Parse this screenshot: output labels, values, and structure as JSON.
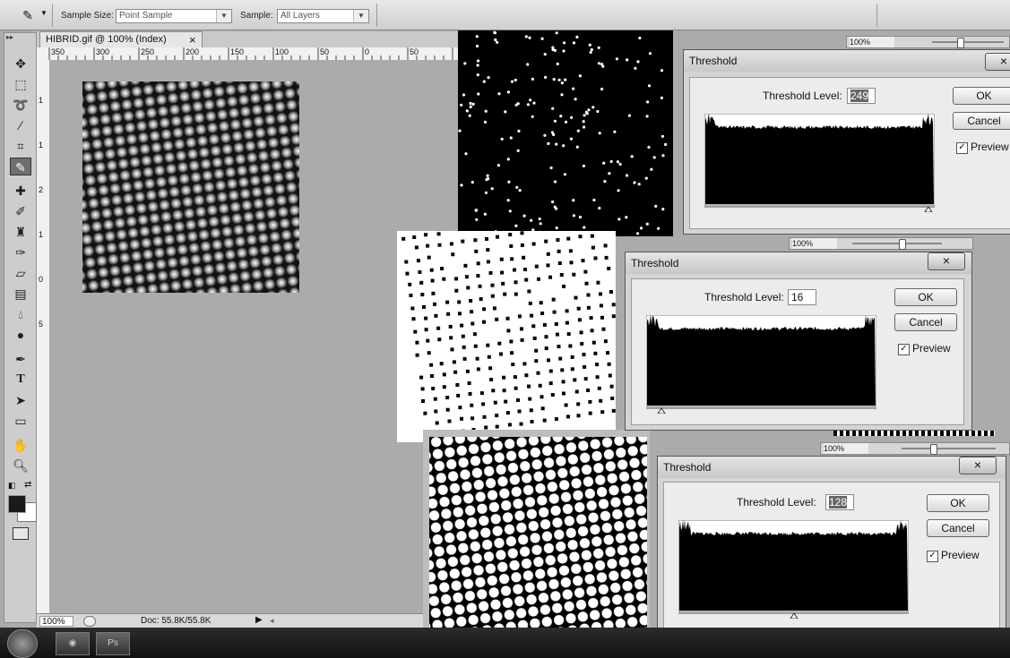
{
  "options_bar": {
    "tool_icon": "eyedropper-icon",
    "sample_size_label": "Sample Size:",
    "sample_size_value": "Point Sample",
    "sample_label": "Sample:",
    "sample_value": "All Layers"
  },
  "document": {
    "tab_title": "HIBRID.gif @ 100% (Index)",
    "close_glyph": "×",
    "hruler_ticks": [
      "350",
      "300",
      "250",
      "200",
      "150",
      "100",
      "50",
      "0",
      "50"
    ],
    "vruler_ticks": [
      "1",
      "1",
      "2",
      "1",
      "0",
      "5"
    ],
    "zoom": "100%",
    "doc_info": "Doc: 55.8K/55.8K"
  },
  "dialogs": [
    {
      "title": "Threshold",
      "level_label": "Threshold Level:",
      "level_value": "249",
      "ok": "OK",
      "cancel": "Cancel",
      "preview": "Preview",
      "preview_checked": true,
      "slider_fraction": 0.976
    },
    {
      "title": "Threshold",
      "level_label": "Threshold Level:",
      "level_value": "16",
      "ok": "OK",
      "cancel": "Cancel",
      "preview": "Preview",
      "preview_checked": true,
      "slider_fraction": 0.063
    },
    {
      "title": "Threshold",
      "level_label": "Threshold Level:",
      "level_value": "128",
      "ok": "OK",
      "cancel": "Cancel",
      "preview": "Preview",
      "preview_checked": true,
      "slider_fraction": 0.502
    }
  ],
  "zoom_bars": [
    "100%",
    "100%",
    "100%"
  ],
  "taskbar": {
    "start_icon": "windows-start-icon",
    "explorer_icon": "explorer-icon",
    "photoshop_label": "Ps"
  },
  "colors": {
    "foreground": "#1a1a1a",
    "background": "#ffffff",
    "workspace": "#ababab"
  }
}
